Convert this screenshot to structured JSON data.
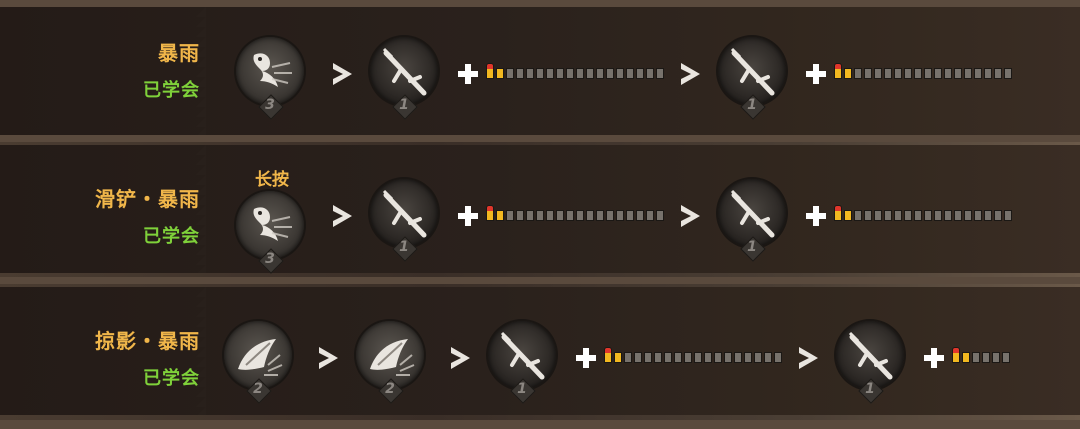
{
  "rows": [
    {
      "skill_name": "暴雨",
      "status": "已学会",
      "hold_label": null,
      "steps": [
        {
          "type": "skill-icon",
          "icon": "dash-bird-icon",
          "count": "3"
        },
        {
          "type": "weapon-icon",
          "icon": "rifle-icon",
          "count": "1",
          "ammo_filled": 2
        },
        {
          "type": "weapon-icon",
          "icon": "rifle-icon",
          "count": "1",
          "ammo_filled": 2
        }
      ]
    },
    {
      "skill_name": "滑铲・暴雨",
      "status": "已学会",
      "hold_label": "长按",
      "steps": [
        {
          "type": "skill-icon",
          "icon": "dash-bird-icon",
          "count": "3"
        },
        {
          "type": "weapon-icon",
          "icon": "rifle-icon",
          "count": "1",
          "ammo_filled": 2
        },
        {
          "type": "weapon-icon",
          "icon": "rifle-icon",
          "count": "1",
          "ammo_filled": 2
        }
      ]
    },
    {
      "skill_name": "掠影・暴雨",
      "status": "已学会",
      "hold_label": null,
      "steps": [
        {
          "type": "skill-icon",
          "icon": "shadow-strike-icon",
          "count": "2"
        },
        {
          "type": "skill-icon",
          "icon": "shadow-strike-icon",
          "count": "2"
        },
        {
          "type": "weapon-icon",
          "icon": "rifle-icon",
          "count": "1",
          "ammo_filled": 2
        },
        {
          "type": "weapon-icon",
          "icon": "rifle-icon",
          "count": "1",
          "ammo_filled": 2
        }
      ]
    }
  ],
  "colors": {
    "skill_name": "#f0b64a",
    "learned": "#7fd13a",
    "ammo_filled": "#f2b820",
    "ammo_tip": "#e0362b",
    "ammo_empty": "#77726c"
  }
}
